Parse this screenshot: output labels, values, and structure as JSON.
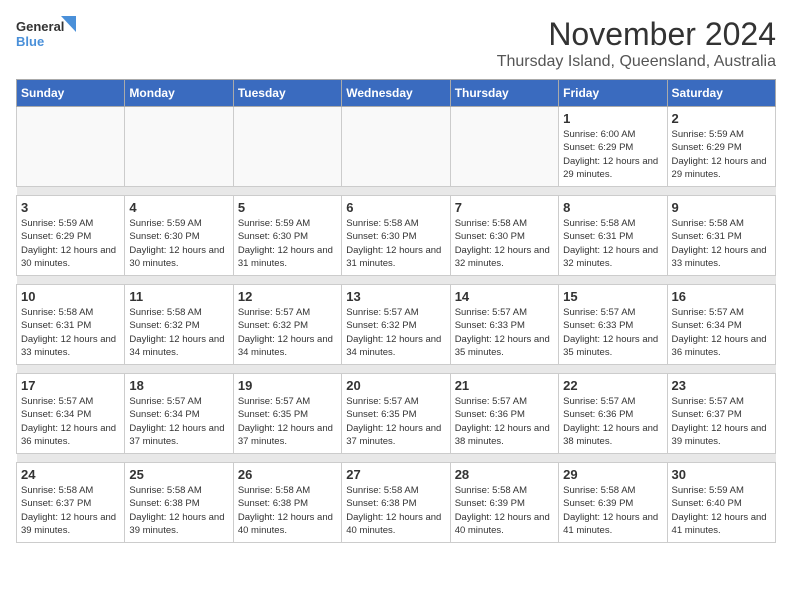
{
  "logo": {
    "text_general": "General",
    "text_blue": "Blue"
  },
  "title": {
    "month": "November 2024",
    "location": "Thursday Island, Queensland, Australia"
  },
  "headers": [
    "Sunday",
    "Monday",
    "Tuesday",
    "Wednesday",
    "Thursday",
    "Friday",
    "Saturday"
  ],
  "weeks": [
    [
      {
        "day": "",
        "info": ""
      },
      {
        "day": "",
        "info": ""
      },
      {
        "day": "",
        "info": ""
      },
      {
        "day": "",
        "info": ""
      },
      {
        "day": "",
        "info": ""
      },
      {
        "day": "1",
        "info": "Sunrise: 6:00 AM\nSunset: 6:29 PM\nDaylight: 12 hours and 29 minutes."
      },
      {
        "day": "2",
        "info": "Sunrise: 5:59 AM\nSunset: 6:29 PM\nDaylight: 12 hours and 29 minutes."
      }
    ],
    [
      {
        "day": "3",
        "info": "Sunrise: 5:59 AM\nSunset: 6:29 PM\nDaylight: 12 hours and 30 minutes."
      },
      {
        "day": "4",
        "info": "Sunrise: 5:59 AM\nSunset: 6:30 PM\nDaylight: 12 hours and 30 minutes."
      },
      {
        "day": "5",
        "info": "Sunrise: 5:59 AM\nSunset: 6:30 PM\nDaylight: 12 hours and 31 minutes."
      },
      {
        "day": "6",
        "info": "Sunrise: 5:58 AM\nSunset: 6:30 PM\nDaylight: 12 hours and 31 minutes."
      },
      {
        "day": "7",
        "info": "Sunrise: 5:58 AM\nSunset: 6:30 PM\nDaylight: 12 hours and 32 minutes."
      },
      {
        "day": "8",
        "info": "Sunrise: 5:58 AM\nSunset: 6:31 PM\nDaylight: 12 hours and 32 minutes."
      },
      {
        "day": "9",
        "info": "Sunrise: 5:58 AM\nSunset: 6:31 PM\nDaylight: 12 hours and 33 minutes."
      }
    ],
    [
      {
        "day": "10",
        "info": "Sunrise: 5:58 AM\nSunset: 6:31 PM\nDaylight: 12 hours and 33 minutes."
      },
      {
        "day": "11",
        "info": "Sunrise: 5:58 AM\nSunset: 6:32 PM\nDaylight: 12 hours and 34 minutes."
      },
      {
        "day": "12",
        "info": "Sunrise: 5:57 AM\nSunset: 6:32 PM\nDaylight: 12 hours and 34 minutes."
      },
      {
        "day": "13",
        "info": "Sunrise: 5:57 AM\nSunset: 6:32 PM\nDaylight: 12 hours and 34 minutes."
      },
      {
        "day": "14",
        "info": "Sunrise: 5:57 AM\nSunset: 6:33 PM\nDaylight: 12 hours and 35 minutes."
      },
      {
        "day": "15",
        "info": "Sunrise: 5:57 AM\nSunset: 6:33 PM\nDaylight: 12 hours and 35 minutes."
      },
      {
        "day": "16",
        "info": "Sunrise: 5:57 AM\nSunset: 6:34 PM\nDaylight: 12 hours and 36 minutes."
      }
    ],
    [
      {
        "day": "17",
        "info": "Sunrise: 5:57 AM\nSunset: 6:34 PM\nDaylight: 12 hours and 36 minutes."
      },
      {
        "day": "18",
        "info": "Sunrise: 5:57 AM\nSunset: 6:34 PM\nDaylight: 12 hours and 37 minutes."
      },
      {
        "day": "19",
        "info": "Sunrise: 5:57 AM\nSunset: 6:35 PM\nDaylight: 12 hours and 37 minutes."
      },
      {
        "day": "20",
        "info": "Sunrise: 5:57 AM\nSunset: 6:35 PM\nDaylight: 12 hours and 37 minutes."
      },
      {
        "day": "21",
        "info": "Sunrise: 5:57 AM\nSunset: 6:36 PM\nDaylight: 12 hours and 38 minutes."
      },
      {
        "day": "22",
        "info": "Sunrise: 5:57 AM\nSunset: 6:36 PM\nDaylight: 12 hours and 38 minutes."
      },
      {
        "day": "23",
        "info": "Sunrise: 5:57 AM\nSunset: 6:37 PM\nDaylight: 12 hours and 39 minutes."
      }
    ],
    [
      {
        "day": "24",
        "info": "Sunrise: 5:58 AM\nSunset: 6:37 PM\nDaylight: 12 hours and 39 minutes."
      },
      {
        "day": "25",
        "info": "Sunrise: 5:58 AM\nSunset: 6:38 PM\nDaylight: 12 hours and 39 minutes."
      },
      {
        "day": "26",
        "info": "Sunrise: 5:58 AM\nSunset: 6:38 PM\nDaylight: 12 hours and 40 minutes."
      },
      {
        "day": "27",
        "info": "Sunrise: 5:58 AM\nSunset: 6:38 PM\nDaylight: 12 hours and 40 minutes."
      },
      {
        "day": "28",
        "info": "Sunrise: 5:58 AM\nSunset: 6:39 PM\nDaylight: 12 hours and 40 minutes."
      },
      {
        "day": "29",
        "info": "Sunrise: 5:58 AM\nSunset: 6:39 PM\nDaylight: 12 hours and 41 minutes."
      },
      {
        "day": "30",
        "info": "Sunrise: 5:59 AM\nSunset: 6:40 PM\nDaylight: 12 hours and 41 minutes."
      }
    ]
  ]
}
